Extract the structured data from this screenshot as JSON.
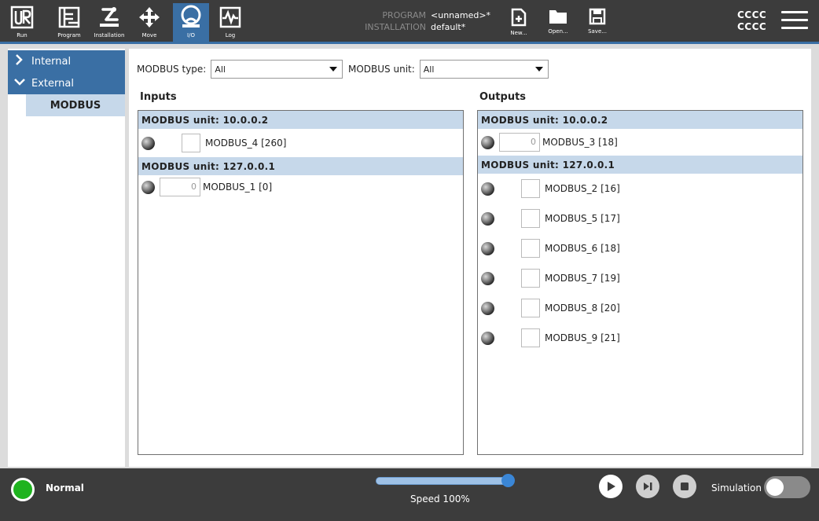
{
  "nav": {
    "items": [
      {
        "label": "Run",
        "icon": "ur-logo-icon"
      },
      {
        "label": "Program",
        "icon": "program-tree-icon"
      },
      {
        "label": "Installation",
        "icon": "robot-arm-icon"
      },
      {
        "label": "Move",
        "icon": "move-arrows-icon"
      },
      {
        "label": "I/O",
        "icon": "io-icon"
      },
      {
        "label": "Log",
        "icon": "log-waveform-icon"
      }
    ],
    "active": "I/O"
  },
  "program_info": {
    "program_key": "PROGRAM",
    "program_value": "<unnamed>*",
    "installation_key": "INSTALLATION",
    "installation_value": "default*"
  },
  "file_buttons": {
    "new_label": "New...",
    "open_label": "Open...",
    "save_label": "Save..."
  },
  "user": {
    "line1": "CCCC",
    "line2": "CCCC"
  },
  "sidebar": {
    "internal_label": "Internal",
    "external_label": "External",
    "modbus_label": "MODBUS"
  },
  "filters": {
    "type_label": "MODBUS type:",
    "type_value": "All",
    "unit_label": "MODBUS unit:",
    "unit_value": "All"
  },
  "inputs": {
    "title": "Inputs",
    "groups": [
      {
        "header": "MODBUS unit: 10.0.0.2",
        "rows": [
          {
            "name": "MODBUS_4 [260]"
          }
        ]
      },
      {
        "header": "MODBUS unit: 127.0.0.1",
        "rows": [
          {
            "name": "MODBUS_1 [0]",
            "value": "0"
          }
        ]
      }
    ]
  },
  "outputs": {
    "title": "Outputs",
    "groups": [
      {
        "header": "MODBUS unit: 10.0.0.2",
        "rows": [
          {
            "name": "MODBUS_3 [18]",
            "value": "0"
          }
        ]
      },
      {
        "header": "MODBUS unit: 127.0.0.1",
        "rows": [
          {
            "name": "MODBUS_2 [16]"
          },
          {
            "name": "MODBUS_5 [17]"
          },
          {
            "name": "MODBUS_6 [18]"
          },
          {
            "name": "MODBUS_7 [19]"
          },
          {
            "name": "MODBUS_8 [20]"
          },
          {
            "name": "MODBUS_9 [21]"
          }
        ]
      }
    ]
  },
  "bottom": {
    "status": "Normal",
    "status_color": "#1fb31f",
    "speed_text": "Speed 100%",
    "speed_fraction": 1.0,
    "simulation_label": "Simulation",
    "simulation_on": false
  },
  "colors": {
    "accent": "#3a6fa4",
    "group_header": "#c6d8ea",
    "bar": "#3c3c3c"
  }
}
